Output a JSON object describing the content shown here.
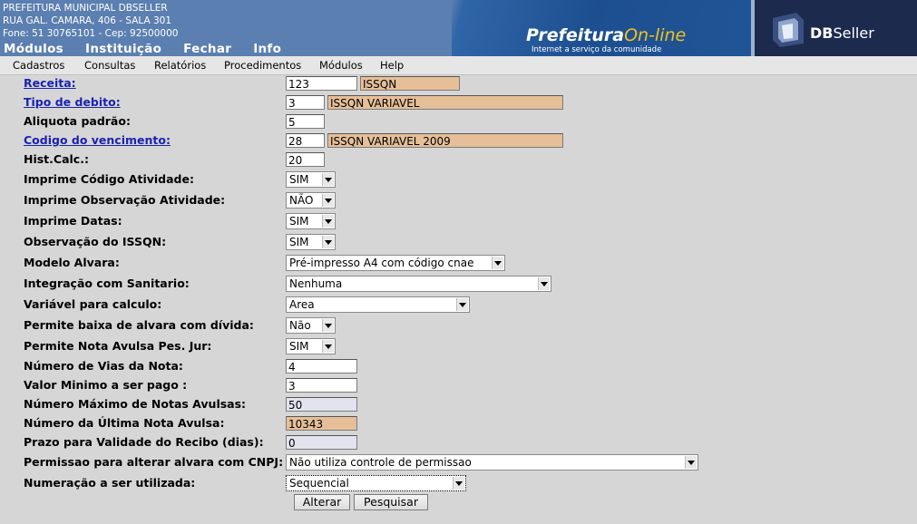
{
  "header": {
    "org_lines": [
      "PREFEITURA MUNICIPAL DBSELLER",
      "RUA GAL. CAMARA, 406 - SALA 301",
      "Fone: 51 30765101  -  Cep: 92500000"
    ],
    "brand_main": "Prefeitura",
    "brand_accent": "On-line",
    "brand_sub": "Internet a serviço da comunidade",
    "company_bold": "DB",
    "company_rest": "Seller",
    "nav": [
      "Módulos",
      "Instituição",
      "Fechar",
      "Info"
    ]
  },
  "menu": [
    "Cadastros",
    "Consultas",
    "Relatórios",
    "Procedimentos",
    "Módulos",
    "Help"
  ],
  "form": {
    "receita": {
      "label": "Receita:",
      "code": "123",
      "desc": "ISSQN"
    },
    "tipo_debito": {
      "label": "Tipo de debito:",
      "code": "3",
      "desc": "ISSQN VARIAVEL"
    },
    "aliquota": {
      "label": "Aliquota padrão:",
      "value": "5"
    },
    "codigo_venc": {
      "label": "Codigo do vencimento:",
      "code": "28",
      "desc": "ISSQN VARIAVEL 2009"
    },
    "hist_calc": {
      "label": "Hist.Calc.:",
      "value": "20"
    },
    "imp_cod_ativ": {
      "label": "Imprime Código Atividade:",
      "value": "SIM"
    },
    "imp_obs_ativ": {
      "label": "Imprime Observação Atividade:",
      "value": "NÃO"
    },
    "imp_datas": {
      "label": "Imprime Datas:",
      "value": "SIM"
    },
    "obs_issqn": {
      "label": "Observação do ISSQN:",
      "value": "SIM"
    },
    "modelo_alvara": {
      "label": "Modelo Alvara:",
      "value": "Pré-impresso A4 com código cnae"
    },
    "integracao": {
      "label": "Integração com Sanitario:",
      "value": "Nenhuma"
    },
    "variavel_calc": {
      "label": "Variável para calculo:",
      "value": "Area"
    },
    "baixa_alvara": {
      "label": "Permite baixa de alvara com dívida:",
      "value": "Não"
    },
    "nota_avulsa_pj": {
      "label": "Permite Nota Avulsa Pes. Jur:",
      "value": "SIM"
    },
    "num_vias": {
      "label": "Número de Vias da Nota:",
      "value": "4"
    },
    "valor_minimo": {
      "label": "Valor Minimo a ser pago :",
      "value": "3"
    },
    "max_notas": {
      "label": "Número Máximo de Notas Avulsas:",
      "value": "50"
    },
    "ultima_nota": {
      "label": "Número da Última Nota Avulsa:",
      "value": "10343"
    },
    "prazo_recibo": {
      "label": "Prazo para Validade do Recibo (dias):",
      "value": "0"
    },
    "perm_cnpj": {
      "label": "Permissao para alterar alvara com CNPJ:",
      "value": "Não utiliza controle de permissao"
    },
    "numeracao": {
      "label": "Numeração a ser utilizada:",
      "value": "Sequencial"
    }
  },
  "buttons": {
    "alterar": "Alterar",
    "pesquisar": "Pesquisar"
  },
  "colors": {
    "header_blue": "#5b7fb0",
    "dark_navy": "#1c2a4d",
    "readonly_orange": "#e6bf98",
    "link": "#1a23b0"
  }
}
